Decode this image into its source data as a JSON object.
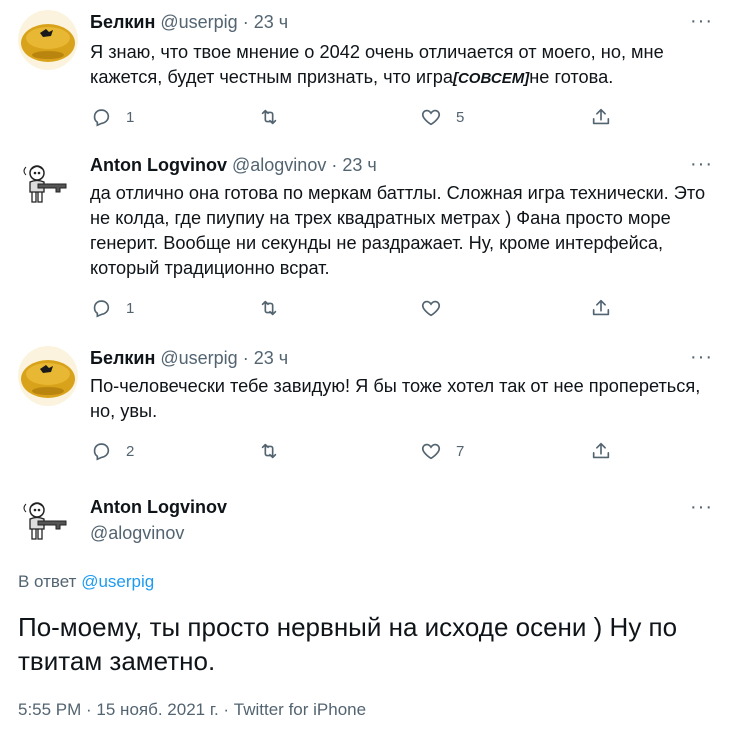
{
  "thread": [
    {
      "name": "Белкин",
      "handle": "@userpig",
      "dot": "·",
      "time": "23 ч",
      "text_before": "Я знаю, что твое мнение о 2042 очень отличается от моего, но, мне кажется, будет честным признать, что игра",
      "text_insert": "[СОВСЕМ]",
      "text_after": "не готова.",
      "reply_count": "1",
      "retweet_count": "",
      "like_count": "5"
    },
    {
      "name": "Anton Logvinov",
      "handle": "@alogvinov",
      "dot": "·",
      "time": "23 ч",
      "text": "да отлично она готова по меркам баттлы. Сложная игра технически. Это не колда, где пиупиу на трех квадратных метрах ) Фана просто море генерит. Вообще ни секунды не раздражает. Ну, кроме интерфейса, который традиционно всрат.",
      "reply_count": "1",
      "retweet_count": "",
      "like_count": ""
    },
    {
      "name": "Белкин",
      "handle": "@userpig",
      "dot": "·",
      "time": "23 ч",
      "text": "По-человечески тебе завидую! Я бы тоже хотел так от нее пропереться, но, увы.",
      "reply_count": "2",
      "retweet_count": "",
      "like_count": "7"
    }
  ],
  "main": {
    "name": "Anton Logvinov",
    "handle": "@alogvinov",
    "reply_prefix": "В ответ",
    "reply_handle": "@userpig",
    "text": "По-моему, ты просто нервный на исходе осени ) Ну по твитам заметно.",
    "meta": "5:55 PM · 15 нояб. 2021 г. · Twitter for iPhone"
  },
  "icons": {
    "more": "more-dots-icon",
    "reply": "reply-bubble-icon",
    "retweet": "retweet-icon",
    "like": "heart-icon",
    "share": "share-icon"
  },
  "colors": {
    "text": "#0f1419",
    "secondary": "#536471",
    "link": "#1d9bf0",
    "avatar_pig": "#d9a21b"
  }
}
